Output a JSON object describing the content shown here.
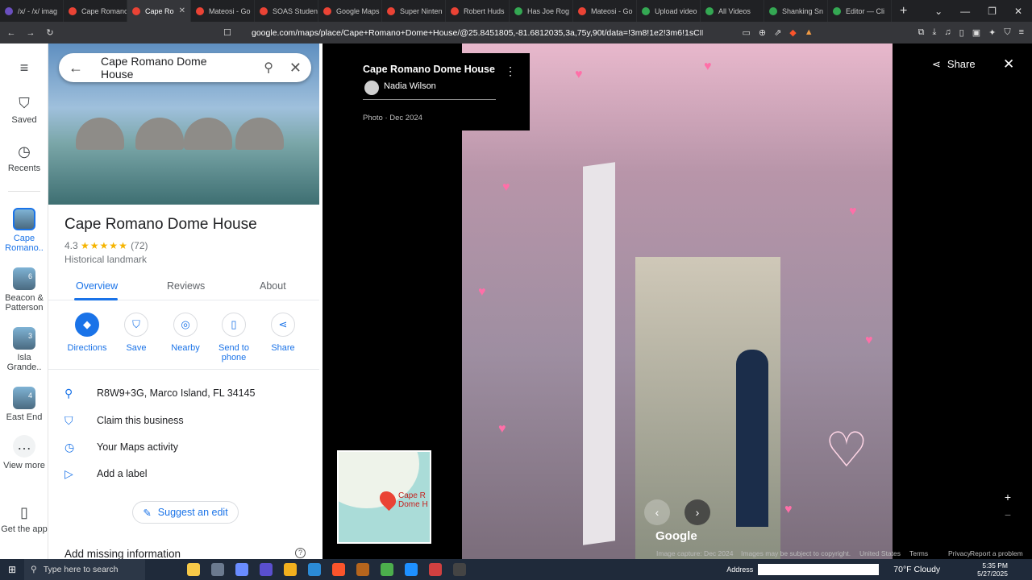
{
  "browser": {
    "tabs": [
      {
        "title": "/x/ - /x/ imag",
        "favicon_color": "#6a4fbf"
      },
      {
        "title": "Cape Romano",
        "favicon_color": "#ea4335"
      },
      {
        "title": "Cape Ro",
        "favicon_color": "#ea4335"
      },
      {
        "title": "Mateosi - Go",
        "favicon_color": "#ea4335"
      },
      {
        "title": "SOAS Studen",
        "favicon_color": "#ea4335"
      },
      {
        "title": "Google Maps",
        "favicon_color": "#ea4335"
      },
      {
        "title": "Super Ninten",
        "favicon_color": "#ea4335"
      },
      {
        "title": "Robert Huds",
        "favicon_color": "#ea4335"
      },
      {
        "title": "Has Joe Rog",
        "favicon_color": "#34a853"
      },
      {
        "title": "Mateosi - Go",
        "favicon_color": "#ea4335"
      },
      {
        "title": "Upload video",
        "favicon_color": "#34a853"
      },
      {
        "title": "All Videos",
        "favicon_color": "#34a853"
      },
      {
        "title": "Shanking Sn",
        "favicon_color": "#34a853"
      },
      {
        "title": "Editor — Cli",
        "favicon_color": "#34a853"
      }
    ],
    "url": "google.com/maps/place/Cape+Romano+Dome+House/@25.8451805,-81.6812035,3a,75y,90t/data=!3m8!1e2!3m6!1sCIHM0ogKEICAgICh"
  },
  "leftnav": {
    "saved": "Saved",
    "recents": "Recents",
    "recent_items": [
      {
        "label": "Cape Romano..",
        "count": ""
      },
      {
        "label": "Beacon & Patterson",
        "count": "6"
      },
      {
        "label": "Isla Grande..",
        "count": "3"
      },
      {
        "label": "East End",
        "count": "4"
      }
    ],
    "view_more": "View more",
    "get_app": "Get the app"
  },
  "search": {
    "query": "Cape Romano Dome House"
  },
  "place": {
    "name": "Cape Romano Dome House",
    "rating": "4.3",
    "stars": "★★★★★",
    "reviews_count": "(72)",
    "category": "Historical landmark"
  },
  "tabs": {
    "overview": "Overview",
    "reviews": "Reviews",
    "about": "About"
  },
  "actions": {
    "directions": "Directions",
    "save": "Save",
    "nearby": "Nearby",
    "send_to_phone": "Send to phone",
    "share": "Share"
  },
  "info": {
    "address": "R8W9+3G, Marco Island, FL 34145",
    "claim": "Claim this business",
    "activity": "Your Maps activity",
    "label": "Add a label"
  },
  "suggest_edit": "Suggest an edit",
  "add_missing": "Add missing information",
  "photo": {
    "title": "Cape Romano Dome House",
    "author": "Nadia Wilson",
    "date": "Photo · Dec 2024"
  },
  "minimap": {
    "label": "Cape R Dome H"
  },
  "viewer": {
    "share": "Share",
    "google": "Google",
    "capture": "Image capture: Dec 2024",
    "copyright": "Images may be subject to copyright.",
    "country": "United States",
    "terms": "Terms",
    "privacy": "Privacy",
    "report": "Report a problem"
  },
  "taskbar": {
    "search_placeholder": "Type here to search",
    "address": "Address",
    "weather": "70°F  Cloudy",
    "time": "5:35 PM",
    "date": "5/27/2025"
  }
}
